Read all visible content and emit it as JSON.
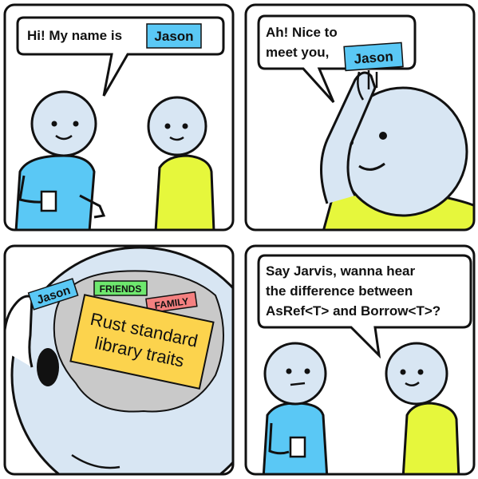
{
  "panels": [
    {
      "speech": "Hi! My name is",
      "name_tag": "Jason"
    },
    {
      "speech_line1": "Ah! Nice to",
      "speech_line2": "meet you,",
      "name_tag": "Jason"
    },
    {
      "name_tag": "Jason",
      "friends_tag": "FRIENDS",
      "family_tag": "FAMILY",
      "note_line1": "Rust standard",
      "note_line2": "library traits"
    },
    {
      "speech_line1": "Say Jarvis, wanna hear",
      "speech_line2": "the difference between",
      "speech_line3": "AsRef<T> and Borrow<T>?"
    }
  ],
  "colors": {
    "blue": "#5ac8f5",
    "yellow": "#e6f73c",
    "orange": "#fcd34d",
    "green": "#6ee86e",
    "red": "#f48080",
    "brain": "#c9c9c9",
    "skin": "#d8e6f3"
  }
}
